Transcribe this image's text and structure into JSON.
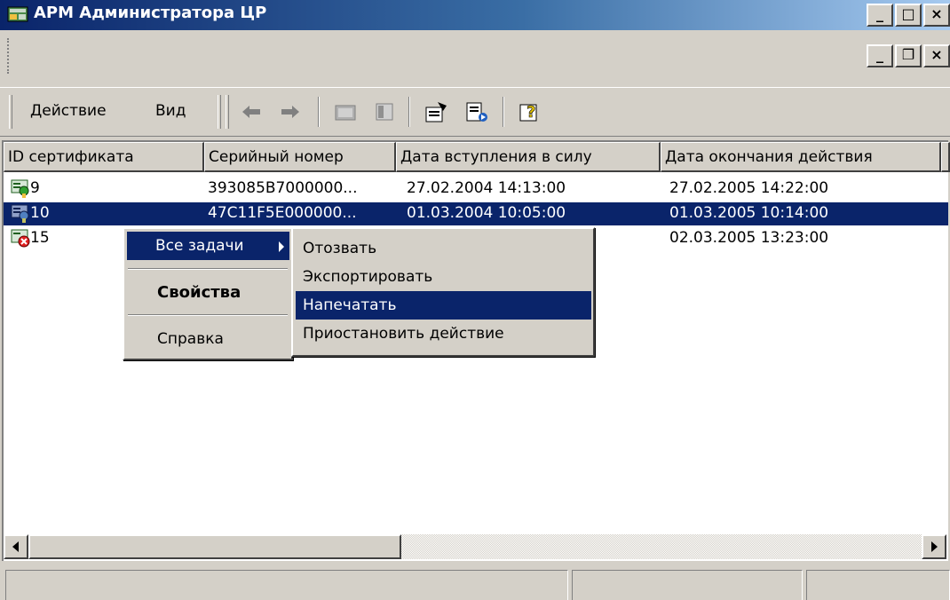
{
  "window": {
    "title": "АРМ Администратора ЦР",
    "minimize": "_",
    "maximize": "□",
    "close": "×"
  },
  "mdi": {
    "minimize": "_",
    "restore": "❐",
    "close": "×"
  },
  "menubar": {
    "action_label": "Действие",
    "view_label": "Вид"
  },
  "table": {
    "columns": [
      "ID сертификата",
      "Серийный номер",
      "Дата вступления в силу",
      "Дата окончания действия"
    ],
    "rows": [
      {
        "id": "9",
        "serial": "393085B7000000...",
        "valid_from": "27.02.2004 14:13:00",
        "valid_to": "27.02.2005 14:22:00",
        "status_icon": "certificate-valid-icon"
      },
      {
        "id": "10",
        "serial": "47C11F5E000000...",
        "valid_from": "01.03.2004 10:05:00",
        "valid_to": "01.03.2005 10:14:00",
        "status_icon": "certificate-valid-icon",
        "selected": true
      },
      {
        "id": "15",
        "serial": "",
        "valid_from": "",
        "valid_to": "02.03.2005 13:23:00",
        "status_icon": "certificate-revoked-icon"
      }
    ]
  },
  "context_menu": {
    "all_tasks": "Все задачи",
    "properties": "Свойства",
    "help": "Справка"
  },
  "submenu": {
    "items": [
      "Отозвать",
      "Экспортировать",
      "Напечатать",
      "Приостановить действие"
    ],
    "highlighted_index": 2
  },
  "colors": {
    "title_start": "#0a246a",
    "title_end": "#a6caf0",
    "selection": "#0a246a",
    "face": "#d4d0c8"
  }
}
